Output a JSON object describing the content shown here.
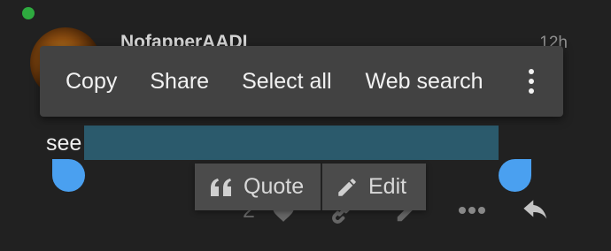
{
  "post": {
    "username": "NofapperAADI",
    "timestamp": "12h",
    "body_text": "see",
    "like_count": "2"
  },
  "selection_toolbar": {
    "items": [
      {
        "label": "Copy"
      },
      {
        "label": "Share"
      },
      {
        "label": "Select all"
      },
      {
        "label": "Web search"
      }
    ],
    "overflow_icon": "more-vert-icon"
  },
  "quote_popup": {
    "quote_label": "Quote",
    "edit_label": "Edit"
  },
  "icons": {
    "like": "heart-icon",
    "link": "link-icon",
    "edit": "pencil-icon",
    "more": "more-horiz-icon",
    "reply": "reply-icon"
  },
  "colors": {
    "background": "#212121",
    "toolbar": "#424242",
    "selection_highlight": "#2b5a6c",
    "selection_handle": "#4aa0f0",
    "online_dot": "#2eaa3f"
  }
}
